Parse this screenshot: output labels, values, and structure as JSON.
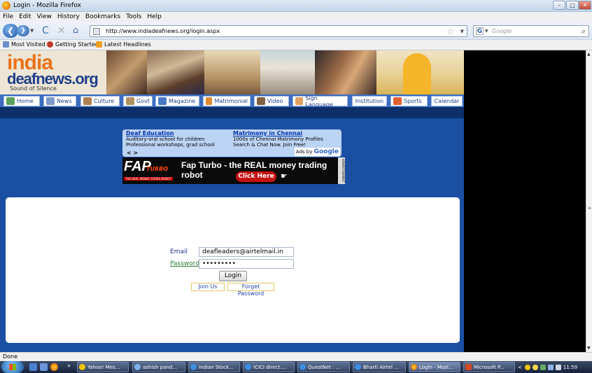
{
  "window": {
    "title": "Login - Mozilla Firefox",
    "minimize": "–",
    "maximize": "□",
    "close": "✕"
  },
  "menubar": [
    "File",
    "Edit",
    "View",
    "History",
    "Bookmarks",
    "Tools",
    "Help"
  ],
  "nav": {
    "back_glyph": "❮",
    "forward_glyph": "❯",
    "reload_glyph": "C",
    "stop_glyph": "✕",
    "home_glyph": "⌂",
    "url": "http://www.indiadeafnews.org/login.aspx",
    "search_placeholder": "Google",
    "search_engine_letter": "G"
  },
  "bookmarks": [
    "Most Visited",
    "Getting Started",
    "Latest Headlines"
  ],
  "site": {
    "logo_top": "india",
    "logo_bottom": "deafnews.org",
    "tagline": "Sound of Silence",
    "menu": [
      "Home",
      "News",
      "Culture",
      "Govt",
      "Magazine",
      "Matrimonial",
      "Video",
      "Sign Language",
      "Institution",
      "Sports",
      "Calendar"
    ]
  },
  "text_ad": {
    "left_title": "Deaf Education",
    "left_line1": "Auditory-oral school for children",
    "left_line2": "Professional workshops, grad school",
    "right_title": "Matrimony in Chennai",
    "right_line1": "1000s of Chennai Matrimony Profiles",
    "right_line2": "Search & Chat Now. Join Free!",
    "nav": "< >",
    "ads_by": "Ads by",
    "google": "Google"
  },
  "banner_ad": {
    "brand": "FAP",
    "brand_sub": "TURBO",
    "brand_tag": "THE REAL MONEY FOREX ROBOT",
    "headline": "Fap Turbo - the REAL money trading robot",
    "cta": "Click Here",
    "side": "ADVERTISEMENT"
  },
  "login": {
    "email_label": "Email",
    "email_value": "deafleaders@airtelmail.in",
    "password_label": "Password",
    "password_value": "•••••••••",
    "login_button": "Login",
    "join_link": "Join Us",
    "forgot_link": "Forget Password"
  },
  "status": "Done",
  "taskbar": {
    "items": [
      "Yahoo! Mes...",
      "ashish pand...",
      "Indian Stock...",
      "ICICI direct....",
      "QuestNet : ...",
      "Bharti Airtel ...",
      "Login - Mozi...",
      "Microsoft P..."
    ],
    "chevron": "»",
    "clock": "11:59"
  }
}
